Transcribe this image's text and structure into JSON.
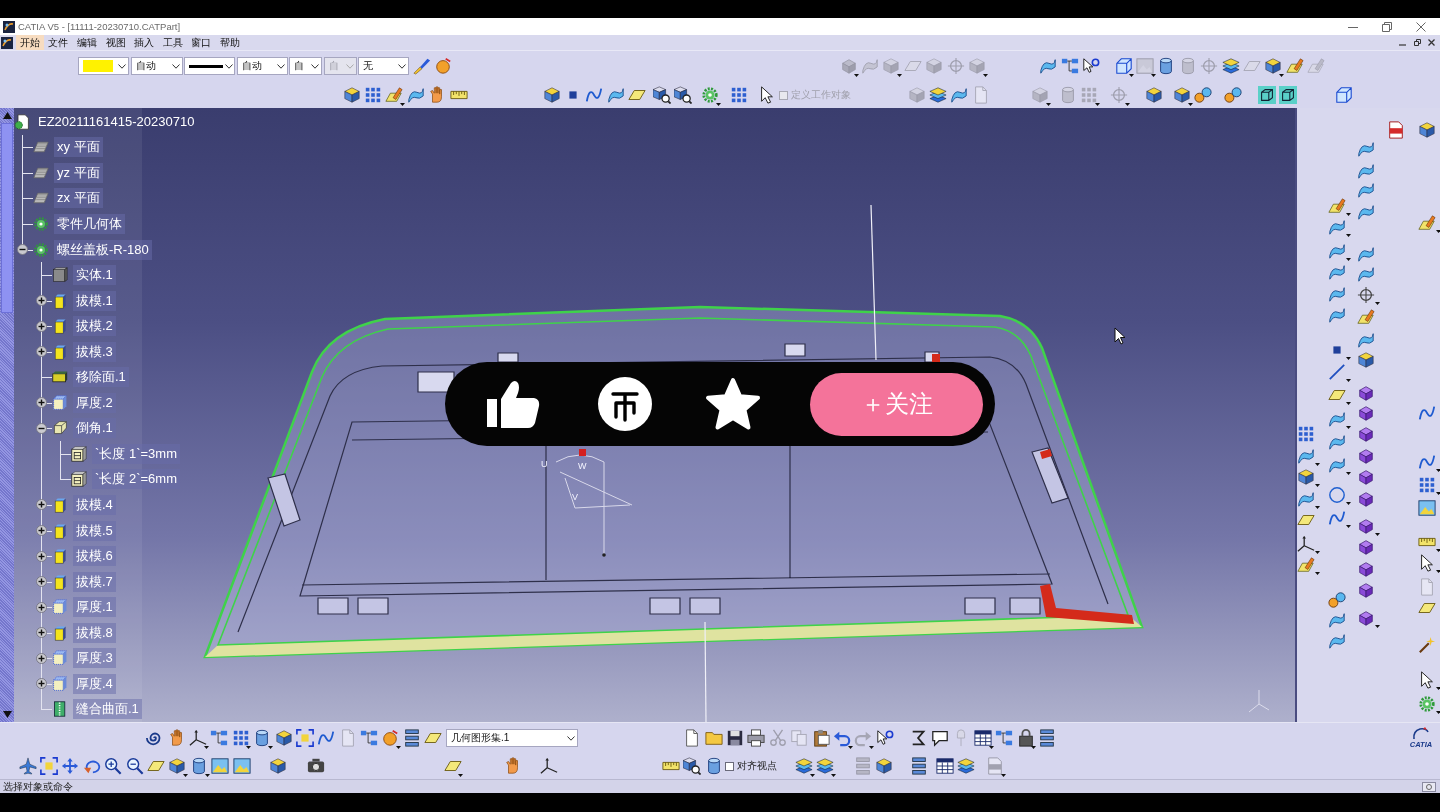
{
  "window": {
    "title": "CATIA V5 - [11111-20230710.CATPart]"
  },
  "menu": [
    {
      "label": "开始",
      "selected": true
    },
    {
      "label": "文件",
      "selected": false
    },
    {
      "label": "编辑",
      "selected": false
    },
    {
      "label": "视图",
      "selected": false
    },
    {
      "label": "插入",
      "selected": false
    },
    {
      "label": "工具",
      "selected": false
    },
    {
      "label": "窗口",
      "selected": false
    },
    {
      "label": "帮助",
      "selected": false
    }
  ],
  "top_toolbars": {
    "row_1": {
      "properties": {
        "fields": [
          {
            "kind": "color",
            "color": "#fff200",
            "disabled": false
          },
          {
            "kind": "text",
            "value": "自动",
            "disabled": false
          },
          {
            "kind": "linetype",
            "disabled": false
          },
          {
            "kind": "text",
            "value": "自动",
            "disabled": false
          },
          {
            "kind": "text",
            "value": "自",
            "disabled": false
          },
          {
            "kind": "text",
            "value": "自",
            "disabled": true
          },
          {
            "kind": "text",
            "value": "无",
            "disabled": false
          }
        ],
        "icons": [
          {
            "kind": "brush",
            "disabled": false
          },
          {
            "kind": "ball",
            "disabled": false
          }
        ]
      },
      "groups": [
        [
          {
            "kind": "solid",
            "disabled": true,
            "caret": true
          },
          {
            "kind": "surface",
            "disabled": true
          },
          {
            "kind": "cube",
            "disabled": true,
            "caret": true
          },
          {
            "kind": "plane",
            "disabled": true
          },
          {
            "kind": "cube",
            "disabled": true
          },
          {
            "kind": "target",
            "disabled": true
          },
          {
            "kind": "cube",
            "disabled": true,
            "caret": true
          }
        ],
        [
          {
            "kind": "surface",
            "disabled": false
          },
          {
            "kind": "hierarchy",
            "disabled": false
          },
          {
            "kind": "help",
            "disabled": false
          }
        ],
        [
          {
            "kind": "wire-cube",
            "disabled": false,
            "caret": true
          },
          {
            "kind": "image",
            "disabled": true,
            "caret": true
          },
          {
            "kind": "cylinder",
            "disabled": false
          },
          {
            "kind": "cylinder",
            "disabled": true
          },
          {
            "kind": "target",
            "disabled": true
          },
          {
            "kind": "layers",
            "disabled": false
          },
          {
            "kind": "plane",
            "disabled": true
          },
          {
            "kind": "cube",
            "disabled": false,
            "caret": true
          },
          {
            "kind": "sketch",
            "disabled": false
          },
          {
            "kind": "sketch",
            "disabled": true
          }
        ]
      ]
    },
    "row_2": {
      "groups": [
        [
          {
            "kind": "cube",
            "disabled": false
          },
          {
            "kind": "grid",
            "disabled": false
          },
          {
            "kind": "sketch",
            "disabled": false,
            "caret": true
          },
          {
            "kind": "surface",
            "disabled": false
          },
          {
            "kind": "hand",
            "disabled": false
          },
          {
            "kind": "ruler",
            "disabled": false
          }
        ],
        [
          {
            "kind": "cube",
            "disabled": false
          },
          {
            "kind": "dot",
            "disabled": false
          },
          {
            "kind": "curve",
            "disabled": false
          },
          {
            "kind": "surface",
            "disabled": false
          },
          {
            "kind": "plane",
            "disabled": false
          }
        ],
        [
          {
            "kind": "inspect",
            "disabled": false
          },
          {
            "kind": "inspect",
            "disabled": false
          }
        ],
        [
          {
            "kind": "gear",
            "disabled": false,
            "caret": true
          }
        ],
        [
          {
            "kind": "grid",
            "disabled": false
          }
        ],
        [
          {
            "kind": "pointer",
            "disabled": false
          }
        ],
        [
          {
            "kind": "cube",
            "disabled": true
          },
          {
            "kind": "layers",
            "disabled": false
          },
          {
            "kind": "surface",
            "disabled": false
          },
          {
            "kind": "document",
            "disabled": true
          }
        ],
        [
          {
            "kind": "cube",
            "disabled": true,
            "caret": true
          }
        ],
        [
          {
            "kind": "cylinder",
            "disabled": true
          },
          {
            "kind": "grid",
            "disabled": true,
            "caret": true
          }
        ],
        [
          {
            "kind": "target",
            "disabled": true,
            "caret": true
          }
        ],
        [
          {
            "kind": "cube",
            "disabled": false
          }
        ],
        [
          {
            "kind": "cube",
            "disabled": false,
            "caret": true
          },
          {
            "kind": "spheres",
            "disabled": false
          }
        ],
        [
          {
            "kind": "spheres",
            "disabled": false
          }
        ],
        [
          {
            "kind": "teal-cube",
            "disabled": false
          },
          {
            "kind": "teal-cube",
            "disabled": false
          }
        ],
        [
          {
            "kind": "wire-cube",
            "disabled": false
          }
        ]
      ],
      "work_object": {
        "label": "定义工作对象",
        "checked": false,
        "disabled": true
      }
    }
  },
  "tree": {
    "label": "EZ20211161415-20230710",
    "kind": "part",
    "children": [
      {
        "label": "xy 平面",
        "kind": "plane"
      },
      {
        "label": "yz 平面",
        "kind": "plane"
      },
      {
        "label": "zx 平面",
        "kind": "plane"
      },
      {
        "label": "零件几何体",
        "kind": "body"
      },
      {
        "label": "螺丝盖板-R-180",
        "kind": "body",
        "expanded": true,
        "children": [
          {
            "label": "实体.1",
            "kind": "solid"
          },
          {
            "label": "拔模.1",
            "kind": "draft",
            "expanded": false
          },
          {
            "label": "拔模.2",
            "kind": "draft",
            "expanded": false
          },
          {
            "label": "拔模.3",
            "kind": "draft",
            "expanded": false
          },
          {
            "label": "移除面.1",
            "kind": "remove_face"
          },
          {
            "label": "厚度.2",
            "kind": "thickness",
            "expanded": false
          },
          {
            "label": "倒角.1",
            "kind": "chamfer",
            "expanded": true,
            "children": [
              {
                "label": "`长度 1`=3mm",
                "kind": "parameter"
              },
              {
                "label": "`长度 2`=6mm",
                "kind": "parameter"
              }
            ]
          },
          {
            "label": "拔模.4",
            "kind": "draft",
            "expanded": false
          },
          {
            "label": "拔模.5",
            "kind": "draft",
            "expanded": false
          },
          {
            "label": "拔模.6",
            "kind": "draft",
            "expanded": false
          },
          {
            "label": "拔模.7",
            "kind": "draft",
            "expanded": false
          },
          {
            "label": "厚度.1",
            "kind": "thickness",
            "expanded": false
          },
          {
            "label": "拔模.8",
            "kind": "draft",
            "expanded": false
          },
          {
            "label": "厚度.3",
            "kind": "thickness",
            "expanded": false
          },
          {
            "label": "厚度.4",
            "kind": "thickness",
            "expanded": false
          },
          {
            "label": "缝合曲面.1",
            "kind": "sew"
          }
        ]
      }
    ]
  },
  "viewport": {
    "compass_labels": [
      "U",
      "W",
      "V"
    ]
  },
  "video_overlay": {
    "follow_button": "＋关注"
  },
  "right_toolbar": {
    "columns": [
      [
        {
          "kind": "grid",
          "disabled": false
        },
        {
          "kind": "surface",
          "disabled": false,
          "caret": true
        },
        {
          "kind": "cube",
          "disabled": false,
          "caret": true
        },
        {
          "kind": "surface",
          "disabled": false,
          "caret": true
        },
        {
          "kind": "plane",
          "disabled": false
        },
        {
          "kind": "axes",
          "disabled": false,
          "caret": true
        },
        {
          "kind": "sketch",
          "disabled": false,
          "caret": true
        }
      ],
      [
        {
          "kind": "sketch",
          "disabled": false,
          "caret": true
        },
        {
          "kind": "surface",
          "disabled": false,
          "caret": true
        },
        {
          "kind": "surface",
          "disabled": false,
          "caret": true
        },
        {
          "kind": "surface",
          "disabled": false
        },
        {
          "kind": "surface",
          "disabled": false
        },
        {
          "kind": "surface",
          "disabled": false
        },
        {
          "kind": "dot",
          "disabled": false,
          "caret": true
        },
        {
          "kind": "line",
          "disabled": false,
          "caret": true
        },
        {
          "kind": "plane",
          "disabled": false,
          "caret": true
        },
        {
          "kind": "surface",
          "disabled": false,
          "caret": true
        },
        {
          "kind": "surface",
          "disabled": false
        },
        {
          "kind": "surface",
          "disabled": false,
          "caret": true
        },
        {
          "kind": "circle",
          "disabled": false,
          "caret": true
        },
        {
          "kind": "curve",
          "disabled": false,
          "caret": true
        },
        {
          "kind": "spheres",
          "disabled": false
        },
        {
          "kind": "surface",
          "disabled": false
        },
        {
          "kind": "surface",
          "disabled": false
        }
      ],
      [
        {
          "kind": "surface",
          "disabled": false
        },
        {
          "kind": "surface",
          "disabled": false
        },
        {
          "kind": "surface",
          "disabled": false
        },
        {
          "kind": "surface",
          "disabled": false
        },
        {
          "kind": "surface",
          "disabled": false
        },
        {
          "kind": "surface",
          "disabled": false
        },
        {
          "kind": "target",
          "disabled": false,
          "caret": true
        },
        {
          "kind": "sketch",
          "disabled": false
        },
        {
          "kind": "surface",
          "disabled": false
        },
        {
          "kind": "cube",
          "disabled": false
        },
        {
          "kind": "solid",
          "disabled": false
        },
        {
          "kind": "solid",
          "disabled": false
        },
        {
          "kind": "solid",
          "disabled": false
        },
        {
          "kind": "solid",
          "disabled": false
        },
        {
          "kind": "solid",
          "disabled": false
        },
        {
          "kind": "solid",
          "disabled": false
        },
        {
          "kind": "solid",
          "disabled": false,
          "caret": true
        },
        {
          "kind": "solid",
          "disabled": false
        },
        {
          "kind": "solid",
          "disabled": false
        },
        {
          "kind": "solid",
          "disabled": false
        },
        {
          "kind": "solid",
          "disabled": false,
          "caret": true
        }
      ],
      [
        {
          "kind": "file",
          "disabled": false
        }
      ],
      [
        {
          "kind": "cube",
          "disabled": false
        },
        {
          "kind": "sketch",
          "disabled": false,
          "caret": true
        },
        {
          "kind": "curve",
          "disabled": false
        },
        {
          "kind": "curve",
          "disabled": false,
          "caret": true
        },
        {
          "kind": "grid",
          "disabled": false,
          "caret": true
        },
        {
          "kind": "image",
          "disabled": false
        },
        {
          "kind": "ruler",
          "disabled": false,
          "caret": true
        },
        {
          "kind": "pointer",
          "disabled": false,
          "caret": true
        },
        {
          "kind": "document",
          "disabled": true
        },
        {
          "kind": "plane",
          "disabled": false
        },
        {
          "kind": "wand",
          "disabled": false
        },
        {
          "kind": "pointer",
          "disabled": false,
          "caret": true
        },
        {
          "kind": "gear",
          "disabled": false,
          "caret": true
        }
      ]
    ]
  },
  "bottom_toolbars": {
    "row_1": {
      "groups": [
        [
          {
            "kind": "spiral",
            "disabled": false
          },
          {
            "kind": "hand",
            "disabled": false
          },
          {
            "kind": "axes",
            "disabled": false,
            "caret": true
          },
          {
            "kind": "hierarchy",
            "disabled": false
          },
          {
            "kind": "grid",
            "disabled": false,
            "caret": true
          },
          {
            "kind": "cylinder",
            "disabled": false,
            "caret": true
          },
          {
            "kind": "cube",
            "disabled": false
          },
          {
            "kind": "frame",
            "disabled": false
          },
          {
            "kind": "curve",
            "disabled": false
          },
          {
            "kind": "document",
            "disabled": true
          },
          {
            "kind": "hierarchy",
            "disabled": false
          },
          {
            "kind": "ball",
            "disabled": false,
            "caret": true
          },
          {
            "kind": "list",
            "disabled": false
          },
          {
            "kind": "plane",
            "disabled": false
          }
        ],
        [
          {
            "kind": "document",
            "disabled": false
          },
          {
            "kind": "folder",
            "disabled": false
          },
          {
            "kind": "save",
            "disabled": false
          },
          {
            "kind": "printer",
            "disabled": false
          },
          {
            "kind": "scissors",
            "disabled": true
          },
          {
            "kind": "copy",
            "disabled": true
          },
          {
            "kind": "clipboard",
            "disabled": false
          },
          {
            "kind": "undo",
            "disabled": false,
            "caret": true
          },
          {
            "kind": "redo",
            "disabled": true,
            "caret": true
          },
          {
            "kind": "help",
            "disabled": false
          }
        ],
        [
          {
            "kind": "formula",
            "disabled": false
          },
          {
            "kind": "speech",
            "disabled": false
          },
          {
            "kind": "pin",
            "disabled": true
          },
          {
            "kind": "table",
            "disabled": false,
            "caret": true
          },
          {
            "kind": "hierarchy",
            "disabled": false
          },
          {
            "kind": "lock",
            "disabled": false,
            "caret": true
          },
          {
            "kind": "list",
            "disabled": false
          }
        ]
      ],
      "geometry_set": "几何图形集.1",
      "logo": "CATIA"
    },
    "row_2": {
      "groups": [
        [
          {
            "kind": "airplane",
            "disabled": false
          },
          {
            "kind": "frame",
            "disabled": false
          },
          {
            "kind": "move",
            "disabled": false
          },
          {
            "kind": "rotate",
            "disabled": false
          },
          {
            "kind": "zoom-in",
            "disabled": false
          },
          {
            "kind": "zoom-out",
            "disabled": false
          },
          {
            "kind": "plane",
            "disabled": false
          },
          {
            "kind": "cube",
            "disabled": false,
            "caret": true
          },
          {
            "kind": "cylinder",
            "disabled": false,
            "caret": true
          },
          {
            "kind": "image",
            "disabled": false
          },
          {
            "kind": "image",
            "disabled": false
          }
        ],
        [
          {
            "kind": "cube",
            "disabled": false
          }
        ],
        [
          {
            "kind": "camera",
            "disabled": false
          }
        ],
        [
          {
            "kind": "plane",
            "disabled": false,
            "caret": true
          }
        ],
        [
          {
            "kind": "hand",
            "disabled": false
          }
        ],
        [
          {
            "kind": "axes",
            "disabled": false
          }
        ],
        [
          {
            "kind": "ruler",
            "disabled": false
          },
          {
            "kind": "inspect",
            "disabled": false
          },
          {
            "kind": "cylinder",
            "disabled": false
          }
        ],
        [
          {
            "kind": "layers",
            "disabled": false,
            "caret": true
          },
          {
            "kind": "layers",
            "disabled": false,
            "caret": true
          }
        ],
        [
          {
            "kind": "list",
            "disabled": true
          },
          {
            "kind": "cube",
            "disabled": false
          }
        ],
        [
          {
            "kind": "list",
            "disabled": false
          }
        ],
        [
          {
            "kind": "table",
            "disabled": false
          },
          {
            "kind": "layers",
            "disabled": false
          }
        ],
        [
          {
            "kind": "file",
            "disabled": true,
            "caret": true
          }
        ]
      ],
      "align_viewpoint": {
        "label": "对齐视点",
        "checked": false,
        "disabled": false
      }
    }
  },
  "status_bar": {
    "message": "选择对象或命令"
  }
}
